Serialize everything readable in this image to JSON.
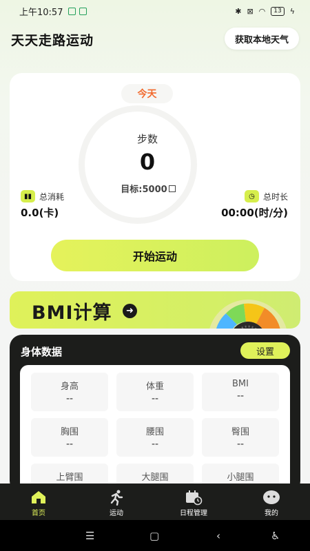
{
  "status_bar": {
    "time": "上午10:57",
    "battery": "13"
  },
  "header": {
    "title": "天天走路运动",
    "weather_button": "获取本地天气"
  },
  "today_card": {
    "badge": "今天",
    "steps_label": "步数",
    "steps_value": "0",
    "goal": "目标:5000",
    "calories_label": "总消耗",
    "calories_value": "0.0(卡)",
    "duration_label": "总时长",
    "duration_value": "00:00(时/分)",
    "start_button": "开始运动"
  },
  "bmi_banner": {
    "title": "BMI计算"
  },
  "body_data": {
    "title": "身体数据",
    "settings_button": "设置",
    "items": [
      {
        "label": "身高",
        "value": "--"
      },
      {
        "label": "体重",
        "value": "--"
      },
      {
        "label": "BMI",
        "value": "--"
      },
      {
        "label": "胸围",
        "value": "--"
      },
      {
        "label": "腰围",
        "value": "--"
      },
      {
        "label": "臀围",
        "value": "--"
      },
      {
        "label": "上臂围",
        "value": "--"
      },
      {
        "label": "大腿围",
        "value": "--"
      },
      {
        "label": "小腿围",
        "value": "--"
      }
    ]
  },
  "bottom_nav": [
    {
      "label": "首页",
      "icon": "home-icon",
      "active": true
    },
    {
      "label": "运动",
      "icon": "running-icon",
      "active": false
    },
    {
      "label": "日程管理",
      "icon": "calendar-icon",
      "active": false
    },
    {
      "label": "我的",
      "icon": "profile-icon",
      "active": false
    }
  ],
  "colors": {
    "accent": "#dff15a",
    "orange": "#f26a2e",
    "dark": "#1c1d1b"
  }
}
